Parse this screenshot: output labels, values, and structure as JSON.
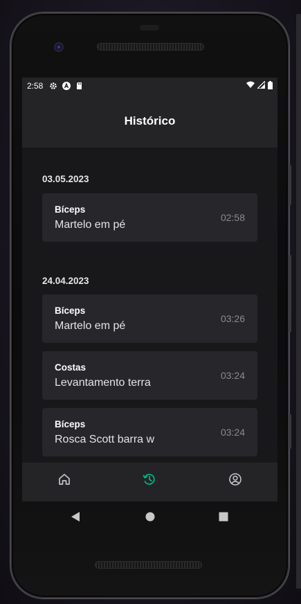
{
  "status_bar": {
    "time": "2:58",
    "icons": [
      "gear-icon",
      "app-a-icon",
      "sd-card-icon"
    ],
    "right_icons": [
      "wifi-icon",
      "signal-icon",
      "battery-icon"
    ]
  },
  "header": {
    "title": "Histórico"
  },
  "history": [
    {
      "date": "03.05.2023",
      "entries": [
        {
          "muscle": "Bíceps",
          "exercise": "Martelo em pé",
          "time": "02:58"
        }
      ]
    },
    {
      "date": "24.04.2023",
      "entries": [
        {
          "muscle": "Bíceps",
          "exercise": "Martelo em pé",
          "time": "03:26"
        },
        {
          "muscle": "Costas",
          "exercise": "Levantamento terra",
          "time": "03:24"
        },
        {
          "muscle": "Bíceps",
          "exercise": "Rosca Scott barra w",
          "time": "03:24"
        }
      ]
    }
  ],
  "bottom_nav": {
    "items": [
      {
        "icon": "home-icon",
        "active": false
      },
      {
        "icon": "history-icon",
        "active": true
      },
      {
        "icon": "profile-icon",
        "active": false
      }
    ],
    "active_color": "#00b37e",
    "inactive_color": "#c4c4cc"
  },
  "system_nav": [
    "back-icon",
    "home-circle-icon",
    "recents-icon"
  ]
}
